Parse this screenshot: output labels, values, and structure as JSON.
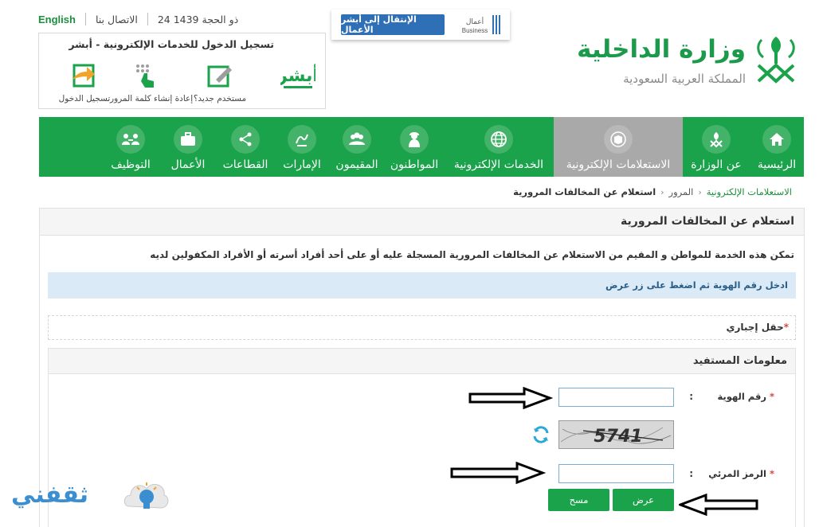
{
  "top_bar": {
    "language": "English",
    "contact": "الاتصال بنا",
    "date": "24 ذو الحجة 1439"
  },
  "absher": {
    "title": "تسجيل الدخول للخدمات الإلكترونية - أبشر",
    "logo_text": "أبشر",
    "items": [
      {
        "label": "مستخدم جديد؟",
        "icon": "new-user-icon"
      },
      {
        "label": "إعادة إنشاء كلمة المرور",
        "icon": "reset-password-icon"
      },
      {
        "label": "تسجيل الدخول",
        "icon": "login-icon"
      }
    ]
  },
  "business": {
    "button": "الإنتقال إلى أبشر الأعمال",
    "logo_ar": "أعمال",
    "logo_en": "Business"
  },
  "brand": {
    "title": "وزارة الداخلية",
    "subtitle": "المملكة العربية السعودية"
  },
  "nav": {
    "items": [
      {
        "label": "الرئيسية",
        "icon": "home-icon",
        "active": false
      },
      {
        "label": "عن الوزارة",
        "icon": "ministry-emblem-icon",
        "active": false
      },
      {
        "label": "الاستعلامات الإلكترونية",
        "icon": "inquiries-icon",
        "active": true
      },
      {
        "label": "الخدمات الإلكترونية",
        "icon": "globe-icon",
        "active": false
      },
      {
        "label": "المواطنون",
        "icon": "citizen-icon",
        "active": false
      },
      {
        "label": "المقيمون",
        "icon": "residents-icon",
        "active": false
      },
      {
        "label": "الإمارات",
        "icon": "emirates-icon",
        "active": false
      },
      {
        "label": "القطاعات",
        "icon": "sectors-icon",
        "active": false
      },
      {
        "label": "الأعمال",
        "icon": "briefcase-icon",
        "active": false
      },
      {
        "label": "التوظيف",
        "icon": "employment-icon",
        "active": false
      }
    ]
  },
  "breadcrumb": {
    "items": [
      "الاستعلامات الإلكترونية",
      "المرور",
      "استعلام عن المخالفات المرورية"
    ]
  },
  "page": {
    "title": "استعلام عن المخالفات المرورية",
    "description": "تمكن هذه الخدمة للمواطن و المقيم من الاستعلام عن المخالفات المرورية المسجلة عليه أو على أحد أفراد أسرته أو الأفراد المكفولين لديه",
    "info": "ادخل رقم الهوية ثم اضغط على زر عرض",
    "required_note": "حقل إجباري",
    "required_star": "*"
  },
  "form": {
    "section_title": "معلومات المستفيد",
    "id_label": "رقم الهوية",
    "id_value": "",
    "captcha_label": "الرمز المرئي",
    "captcha_value": "",
    "captcha_text": "5741",
    "colon": ":",
    "star": "*",
    "submit_button": "عرض",
    "clear_button": "مسح"
  },
  "watermark": {
    "text": "ثقفني"
  },
  "colors": {
    "brand_green": "#1aa34a",
    "active_tab": "#a9a9a9",
    "info_bg": "#dbeaf7",
    "link_blue": "#2f6fb5"
  }
}
